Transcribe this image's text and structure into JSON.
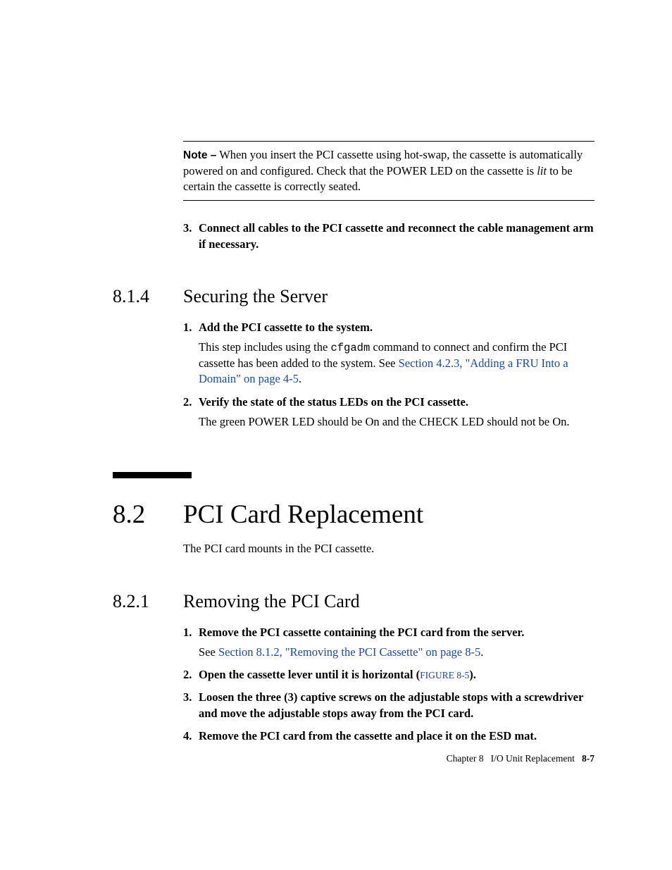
{
  "note": {
    "label": "Note –",
    "text_a": " When you insert the PCI cassette using hot-swap, the cassette is automatically powered on and configured. Check that the POWER LED on the cassette is ",
    "italic": "lit",
    "text_b": " to be certain the cassette is correctly seated."
  },
  "sec813_step3": {
    "num": "3.",
    "bold": "Connect all cables to the PCI cassette and reconnect the cable management arm if necessary."
  },
  "sec814": {
    "num": "8.1.4",
    "title": "Securing the Server",
    "step1": {
      "num": "1.",
      "bold": "Add the PCI cassette to the system.",
      "body_a": "This step includes using the ",
      "mono": "cfgadm",
      "body_b": " command to connect and confirm the PCI cassette has been added to the system. See ",
      "link": "Section 4.2.3, \"Adding a FRU Into a Domain\" on page 4-5",
      "body_c": "."
    },
    "step2": {
      "num": "2.",
      "bold": "Verify the state of the status LEDs on the PCI cassette.",
      "body": "The green POWER LED should be On and the CHECK LED should not be On."
    }
  },
  "sec82": {
    "num": "8.2",
    "title": "PCI Card Replacement",
    "intro": "The PCI card mounts in the PCI cassette."
  },
  "sec821": {
    "num": "8.2.1",
    "title": "Removing the PCI Card",
    "step1": {
      "num": "1.",
      "bold": "Remove the PCI cassette containing the PCI card from the server.",
      "body_a": "See ",
      "link": "Section 8.1.2, \"Removing the PCI Cassette\" on page 8-5",
      "body_b": "."
    },
    "step2": {
      "num": "2.",
      "bold_a": "Open the cassette lever until it is horizontal (",
      "figref": "FIGURE 8-5",
      "bold_b": ")."
    },
    "step3": {
      "num": "3.",
      "bold": "Loosen the three (3) captive screws on the adjustable stops with a screwdriver and move the adjustable stops away from the PCI card."
    },
    "step4": {
      "num": "4.",
      "bold": "Remove the PCI card from the cassette and place it on the ESD mat."
    }
  },
  "footer": {
    "chapter": "Chapter 8",
    "title": "I/O Unit Replacement",
    "page": "8-7"
  }
}
